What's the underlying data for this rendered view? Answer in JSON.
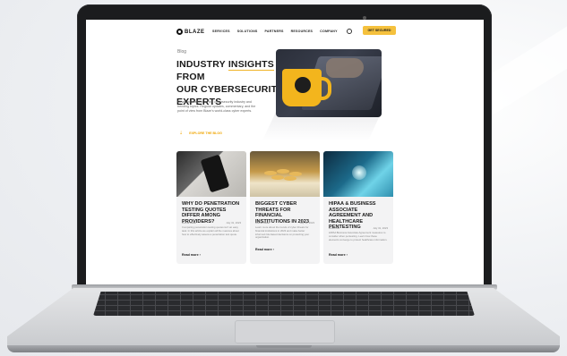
{
  "nav": {
    "logo": "BLAZE",
    "links": [
      "SERVICES",
      "SOLUTIONS",
      "PARTNERS",
      "RESOURCES",
      "COMPANY"
    ],
    "cta": "GET SECURED"
  },
  "hero": {
    "kicker": "Blog",
    "title_line1_pre": "INDUSTRY ",
    "title_line1_hl": "INSIGHTS",
    "title_line1_post": " FROM",
    "title_line2": "OUR CYBERSECURITY",
    "title_line3": "EXPERTS",
    "description": "News and insights on the cybersecurity industry and trending topics. Regular updates, commentary, and the point of view from Blaze's world-class cyber experts.",
    "explore_label": "EXPLORE THE BLOG"
  },
  "cards": [
    {
      "title": "WHY DO PENETRATION TESTING QUOTES DIFFER AMONG PROVIDERS?",
      "author": "Dorina Belan",
      "date": "July 31, 2023",
      "excerpt": "Comparing penetration testing quotes isn't an easy task. In this article we explain all the nuances about how to effectively assess a penetration test quote.",
      "more": "Read more ›"
    },
    {
      "title": "BIGGEST CYBER THREATS FOR FINANCIAL INSTITUTIONS IN 2023",
      "author": "Dorina Belan",
      "date": "July 31, 2023",
      "excerpt": "Learn more about the trends of cyber threats for financial institutions in 2023 and make better informed risk-based decisions on protecting your organization.",
      "more": "Read more ›"
    },
    {
      "title": "HIPAA & BUSINESS ASSOCIATE AGREEMENT AND HEALTHCARE PENTESTING",
      "author": "Lora Pool",
      "date": "July 31, 2023",
      "excerpt": "HIPAA Business Associate Agreement measures to consider when pentesting. Learn how these elements converge to protect healthcare information.",
      "more": "Read more ›"
    }
  ]
}
